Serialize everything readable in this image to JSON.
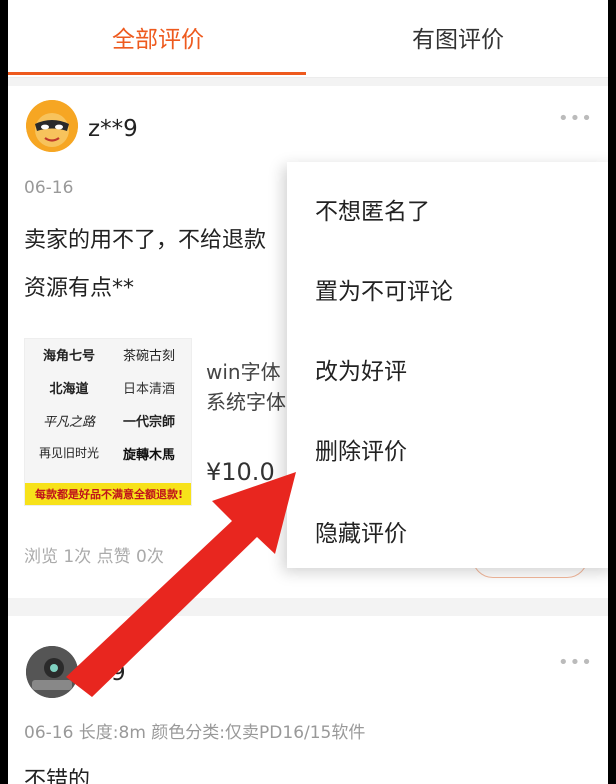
{
  "tabs": [
    {
      "label": "全部评价",
      "active": true
    },
    {
      "label": "有图评价",
      "active": false
    }
  ],
  "review1": {
    "username": "z**9",
    "date": "06-16",
    "text_line1": "卖家的用不了，不给退款",
    "text_line2": "资源有点**",
    "product": {
      "thumb_lines": [
        "海角七号",
        "茶碗古刻",
        "北海道",
        "日本清酒",
        "平凡之路",
        "一代宗師",
        "再见旧时光",
        "旋轉木馬"
      ],
      "banner": "每款都是好品不满意全额退款!",
      "title_line1": "win字体",
      "title_line2": "系统字体",
      "price": "¥10.0"
    },
    "stats": "浏览 1次   点赞 0次"
  },
  "review2": {
    "username": "**9",
    "meta": "06-16 长度:8m 颜色分类:仅卖PD16/15软件",
    "text": "不错的"
  },
  "menu": {
    "items": [
      "不想匿名了",
      "置为不可评论",
      "改为好评",
      "删除评价",
      "隐藏评价"
    ]
  },
  "colors": {
    "accent": "#ee5a1e",
    "arrow": "#e8261f"
  }
}
